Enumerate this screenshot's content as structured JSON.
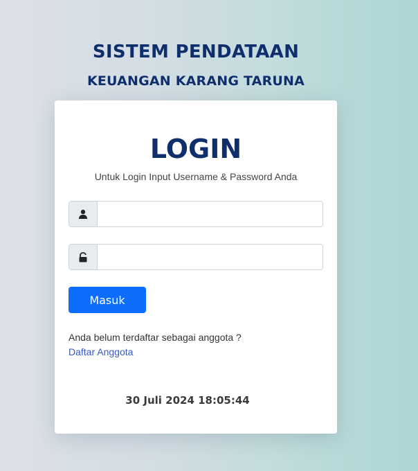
{
  "header": {
    "title": "SISTEM PENDATAAN",
    "subtitle": "KEUANGAN KARANG TARUNA"
  },
  "login": {
    "heading": "LOGIN",
    "description": "Untuk Login Input Username & Password Anda",
    "username": {
      "icon": "user-icon",
      "value": "",
      "placeholder": ""
    },
    "password": {
      "icon": "lock-icon",
      "value": "",
      "placeholder": ""
    },
    "submit_label": "Masuk",
    "register_prompt": "Anda belum terdaftar sebagai anggota ?",
    "register_link": "Daftar Anggota",
    "datetime": "30 Juli 2024 18:05:44"
  },
  "colors": {
    "brand": "#0e2f6b",
    "primary_button": "#0d6efd",
    "link": "#3558c4"
  }
}
